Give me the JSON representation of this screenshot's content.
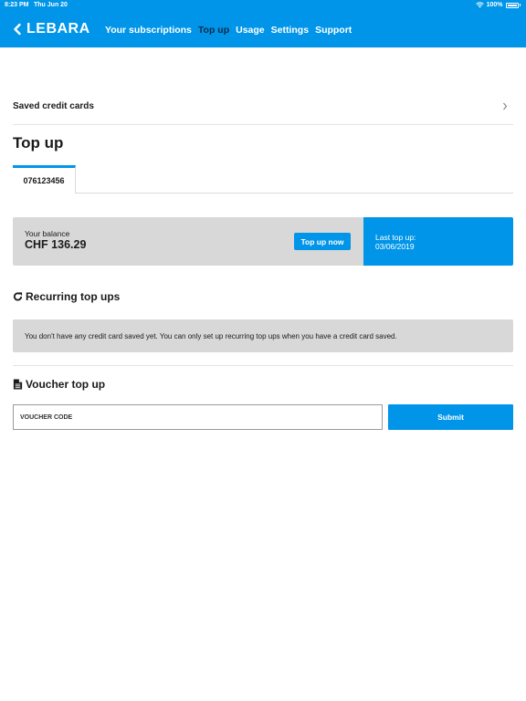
{
  "status_bar": {
    "time": "8:23 PM",
    "date": "Thu Jun 20",
    "battery": "100%"
  },
  "header": {
    "brand": "LEBARA",
    "menu": [
      {
        "label": "Your subscriptions",
        "active": false
      },
      {
        "label": "Top up",
        "active": true
      },
      {
        "label": "Usage",
        "active": false
      },
      {
        "label": "Settings",
        "active": false
      },
      {
        "label": "Support",
        "active": false
      }
    ]
  },
  "saved_cards": {
    "label": "Saved credit cards"
  },
  "page": {
    "title": "Top up"
  },
  "tabs": [
    {
      "label": "076123456",
      "active": true
    }
  ],
  "balance": {
    "label": "Your balance",
    "value": "CHF 136.29",
    "topup_button": "Top up now",
    "last_topup_label": "Last top up:",
    "last_topup_date": "03/06/2019"
  },
  "recurring": {
    "title": "Recurring top ups",
    "notice": "You don't have any credit card saved yet. You can only set up recurring top ups when you have a credit card saved."
  },
  "voucher": {
    "title": "Voucher top up",
    "placeholder": "VOUCHER CODE",
    "submit_label": "Submit"
  },
  "colors": {
    "brand_blue": "#0095e8",
    "active_nav": "#0b2a4a",
    "card_grey": "#d8d8d8"
  }
}
